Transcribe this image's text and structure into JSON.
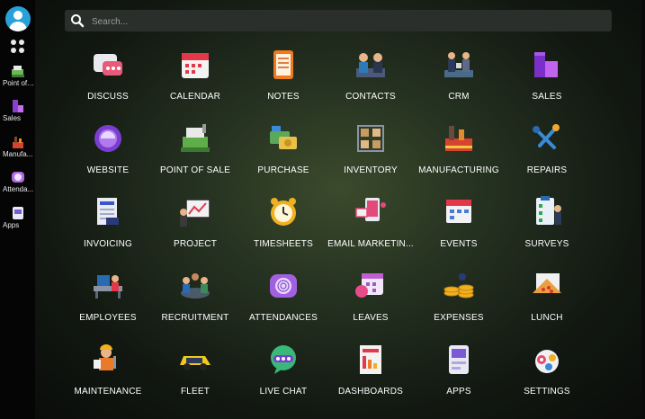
{
  "search": {
    "placeholder": "Search..."
  },
  "sidebar": {
    "items": [
      {
        "label": "Point of ..."
      },
      {
        "label": "Sales"
      },
      {
        "label": "Manufa..."
      },
      {
        "label": "Attenda..."
      },
      {
        "label": "Apps"
      }
    ]
  },
  "apps": [
    {
      "label": "DISCUSS",
      "icon": "discuss-icon"
    },
    {
      "label": "CALENDAR",
      "icon": "calendar-icon"
    },
    {
      "label": "NOTES",
      "icon": "notes-icon"
    },
    {
      "label": "CONTACTS",
      "icon": "contacts-icon"
    },
    {
      "label": "CRM",
      "icon": "crm-icon"
    },
    {
      "label": "SALES",
      "icon": "sales-icon"
    },
    {
      "label": "WEBSITE",
      "icon": "website-icon"
    },
    {
      "label": "POINT OF SALE",
      "icon": "point-of-sale-icon"
    },
    {
      "label": "PURCHASE",
      "icon": "purchase-icon"
    },
    {
      "label": "INVENTORY",
      "icon": "inventory-icon"
    },
    {
      "label": "MANUFACTURING",
      "icon": "manufacturing-icon"
    },
    {
      "label": "REPAIRS",
      "icon": "repairs-icon"
    },
    {
      "label": "INVOICING",
      "icon": "invoicing-icon"
    },
    {
      "label": "PROJECT",
      "icon": "project-icon"
    },
    {
      "label": "TIMESHEETS",
      "icon": "timesheets-icon"
    },
    {
      "label": "EMAIL MARKETIN...",
      "icon": "email-marketing-icon"
    },
    {
      "label": "EVENTS",
      "icon": "events-icon"
    },
    {
      "label": "SURVEYS",
      "icon": "surveys-icon"
    },
    {
      "label": "EMPLOYEES",
      "icon": "employees-icon"
    },
    {
      "label": "RECRUITMENT",
      "icon": "recruitment-icon"
    },
    {
      "label": "ATTENDANCES",
      "icon": "attendances-icon"
    },
    {
      "label": "LEAVES",
      "icon": "leaves-icon"
    },
    {
      "label": "EXPENSES",
      "icon": "expenses-icon"
    },
    {
      "label": "LUNCH",
      "icon": "lunch-icon"
    },
    {
      "label": "MAINTENANCE",
      "icon": "maintenance-icon"
    },
    {
      "label": "FLEET",
      "icon": "fleet-icon"
    },
    {
      "label": "LIVE CHAT",
      "icon": "live-chat-icon"
    },
    {
      "label": "DASHBOARDS",
      "icon": "dashboards-icon"
    },
    {
      "label": "APPS",
      "icon": "apps-icon"
    },
    {
      "label": "SETTINGS",
      "icon": "settings-icon"
    }
  ]
}
